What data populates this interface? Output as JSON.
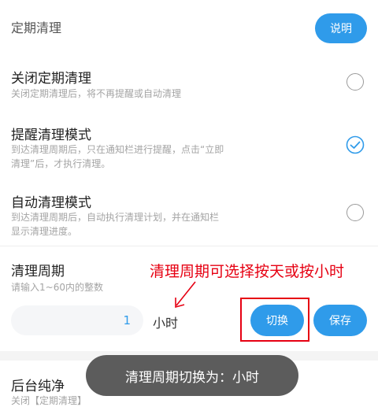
{
  "header": {
    "title": "定期清理",
    "explain_button": "说明"
  },
  "options": [
    {
      "title": "关闭定期清理",
      "desc_lines": [
        "关闭定期清理后，将不再提醒或自动清理"
      ],
      "selected": false
    },
    {
      "title": "提醒清理模式",
      "desc_lines": [
        "到达清理周期后，只在通知栏进行提醒，点击“立即",
        "清理”后，才执行清理。"
      ],
      "selected": true
    },
    {
      "title": "自动清理模式",
      "desc_lines": [
        "到达清理周期后，自动执行清理计划，并在通知栏",
        "显示清理进度。"
      ],
      "selected": false
    }
  ],
  "cycle": {
    "title": "清理周期",
    "hint": "请输入1~60内的整数",
    "value": "1",
    "unit": "小时",
    "switch_button": "切换",
    "save_button": "保存"
  },
  "annotation": {
    "text": "清理周期可选择按天或按小时"
  },
  "background_section": {
    "title": "后台纯净",
    "desc_partial": "关闭【定期清理】"
  },
  "toast": {
    "text": "清理周期切换为：小时"
  },
  "colors": {
    "accent": "#2f9bea",
    "annotation": "#e60012",
    "toast_bg": "#5c5c5c"
  }
}
